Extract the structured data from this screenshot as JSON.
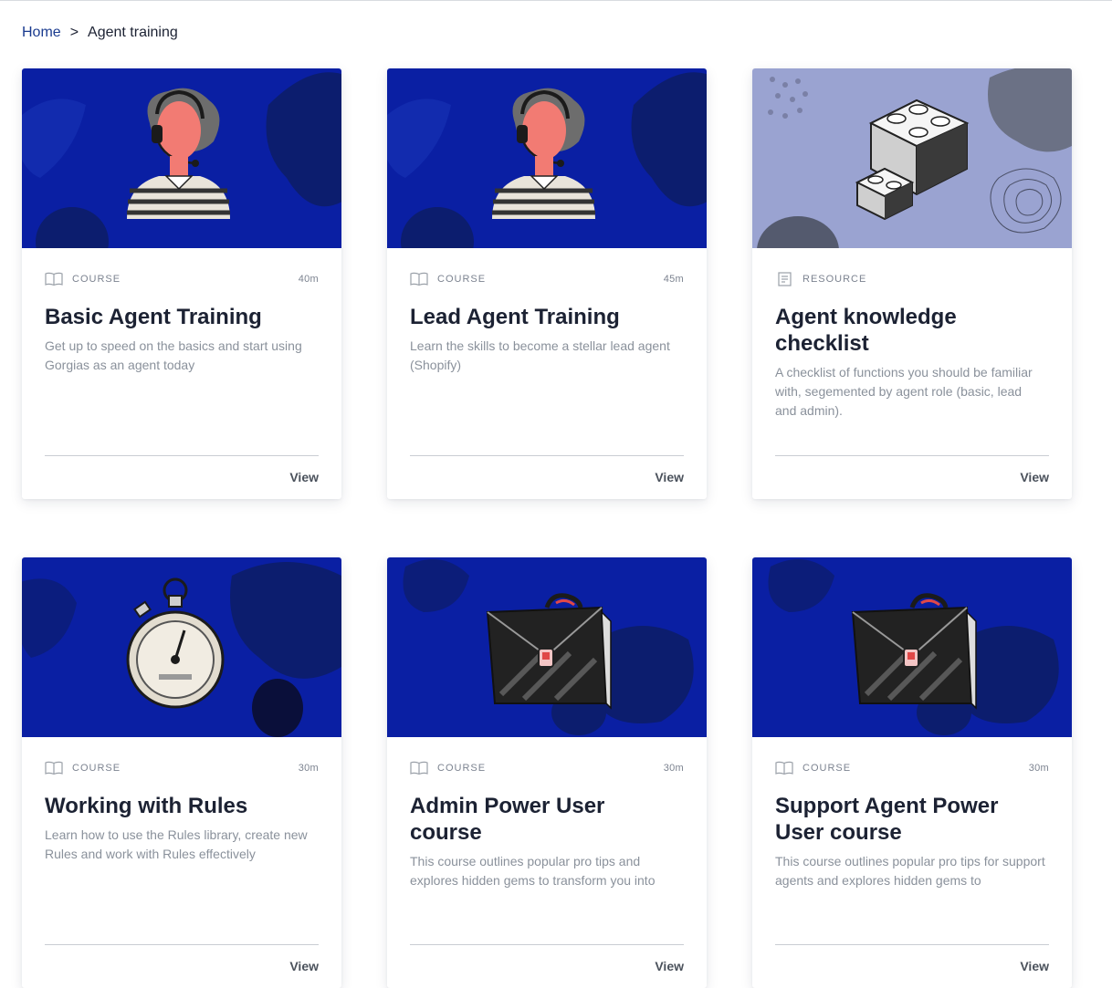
{
  "breadcrumb": {
    "home": "Home",
    "separator": ">",
    "current": "Agent training"
  },
  "colors": {
    "hero_blue": "#0a1fa3",
    "hero_lavender": "#9aa3d1",
    "title": "#1c2233",
    "muted": "#8a919b",
    "link": "#1a3b8f"
  },
  "cards": [
    {
      "type": "COURSE",
      "type_icon": "book-icon",
      "duration": "40m",
      "title": "Basic Agent Training",
      "description": "Get up to speed on the basics and start using Gorgias as an agent today",
      "action": "View",
      "illustration": "agent-headset-illustration"
    },
    {
      "type": "COURSE",
      "type_icon": "book-icon",
      "duration": "45m",
      "title": "Lead Agent Training",
      "description": "Learn the skills to become a stellar lead agent (Shopify)",
      "action": "View",
      "illustration": "agent-headset-illustration"
    },
    {
      "type": "RESOURCE",
      "type_icon": "document-icon",
      "duration": "",
      "title": "Agent knowledge checklist",
      "description": "A checklist of functions you should be familiar with, segemented by agent role (basic, lead and admin).",
      "action": "View",
      "illustration": "building-blocks-illustration"
    },
    {
      "type": "COURSE",
      "type_icon": "book-icon",
      "duration": "30m",
      "title": "Working with Rules",
      "description": "Learn how to use the Rules library, create new Rules and work with Rules effectively",
      "action": "View",
      "illustration": "stopwatch-illustration"
    },
    {
      "type": "COURSE",
      "type_icon": "book-icon",
      "duration": "30m",
      "title": "Admin Power User course",
      "description": "This course outlines popular pro tips and explores hidden gems to transform you into",
      "action": "View",
      "illustration": "briefcase-illustration"
    },
    {
      "type": "COURSE",
      "type_icon": "book-icon",
      "duration": "30m",
      "title": "Support Agent Power User course",
      "description": "This course outlines popular pro tips for support agents and explores hidden gems to",
      "action": "View",
      "illustration": "briefcase-illustration"
    }
  ]
}
